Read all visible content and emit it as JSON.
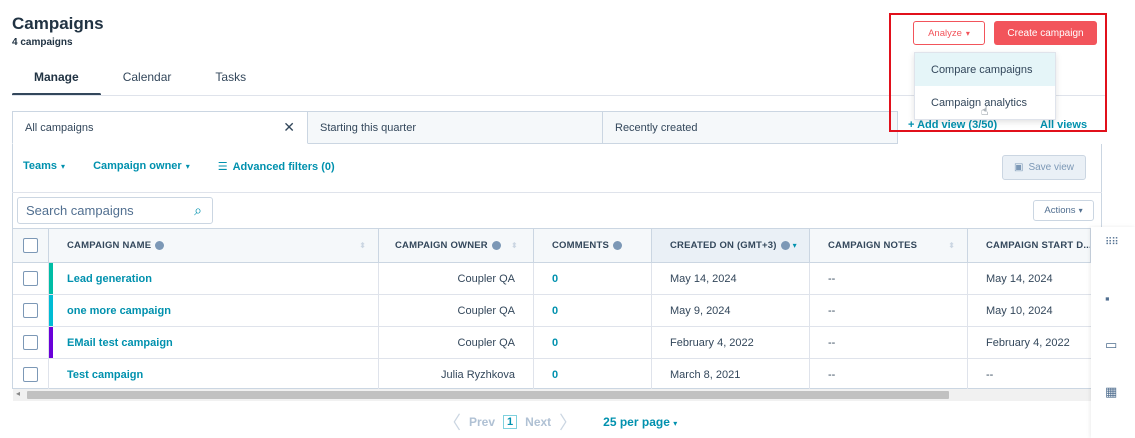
{
  "header": {
    "title": "Campaigns",
    "subtitle": "4 campaigns",
    "analyze_label": "Analyze",
    "create_label": "Create campaign"
  },
  "tabs": [
    {
      "label": "Manage",
      "active": true
    },
    {
      "label": "Calendar",
      "active": false
    },
    {
      "label": "Tasks",
      "active": false
    }
  ],
  "analyze_menu": {
    "items": [
      "Compare campaigns",
      "Campaign analytics"
    ]
  },
  "views": {
    "tabs": [
      "All campaigns",
      "Starting this quarter",
      "Recently created"
    ],
    "close_symbol": "✕",
    "add_view": "+ Add view (3/50)",
    "all_views": "All views"
  },
  "filters": {
    "teams": "Teams",
    "owner": "Campaign owner",
    "advanced": "Advanced filters (0)",
    "save_view": "Save view"
  },
  "search": {
    "placeholder": "Search campaigns"
  },
  "actions_label": "Actions",
  "table": {
    "columns": [
      "CAMPAIGN NAME",
      "CAMPAIGN OWNER",
      "COMMENTS",
      "CREATED ON (GMT+3)",
      "CAMPAIGN NOTES",
      "CAMPAIGN START D..."
    ],
    "rows": [
      {
        "name": "Lead generation",
        "owner": "Coupler QA",
        "comments": "0",
        "created": "May 14, 2024",
        "notes": "--",
        "start": "May 14, 2024",
        "color": "#00bda5"
      },
      {
        "name": "one more campaign",
        "owner": "Coupler QA",
        "comments": "0",
        "created": "May 9, 2024",
        "notes": "--",
        "start": "May 10, 2024",
        "color": "#00bcd4"
      },
      {
        "name": "EMail test campaign",
        "owner": "Coupler QA",
        "comments": "0",
        "created": "February 4, 2022",
        "notes": "--",
        "start": "February 4, 2022",
        "color": "#6a00d9"
      },
      {
        "name": "Test campaign",
        "owner": "Julia Ryzhkova",
        "comments": "0",
        "created": "March 8, 2021",
        "notes": "--",
        "start": "--",
        "color": ""
      }
    ]
  },
  "pagination": {
    "prev": "Prev",
    "page": "1",
    "next": "Next",
    "per_page": "25 per page"
  },
  "colors": {
    "accent": "#0091ae",
    "primary": "#f2545b",
    "highlight": "#e1101b"
  }
}
